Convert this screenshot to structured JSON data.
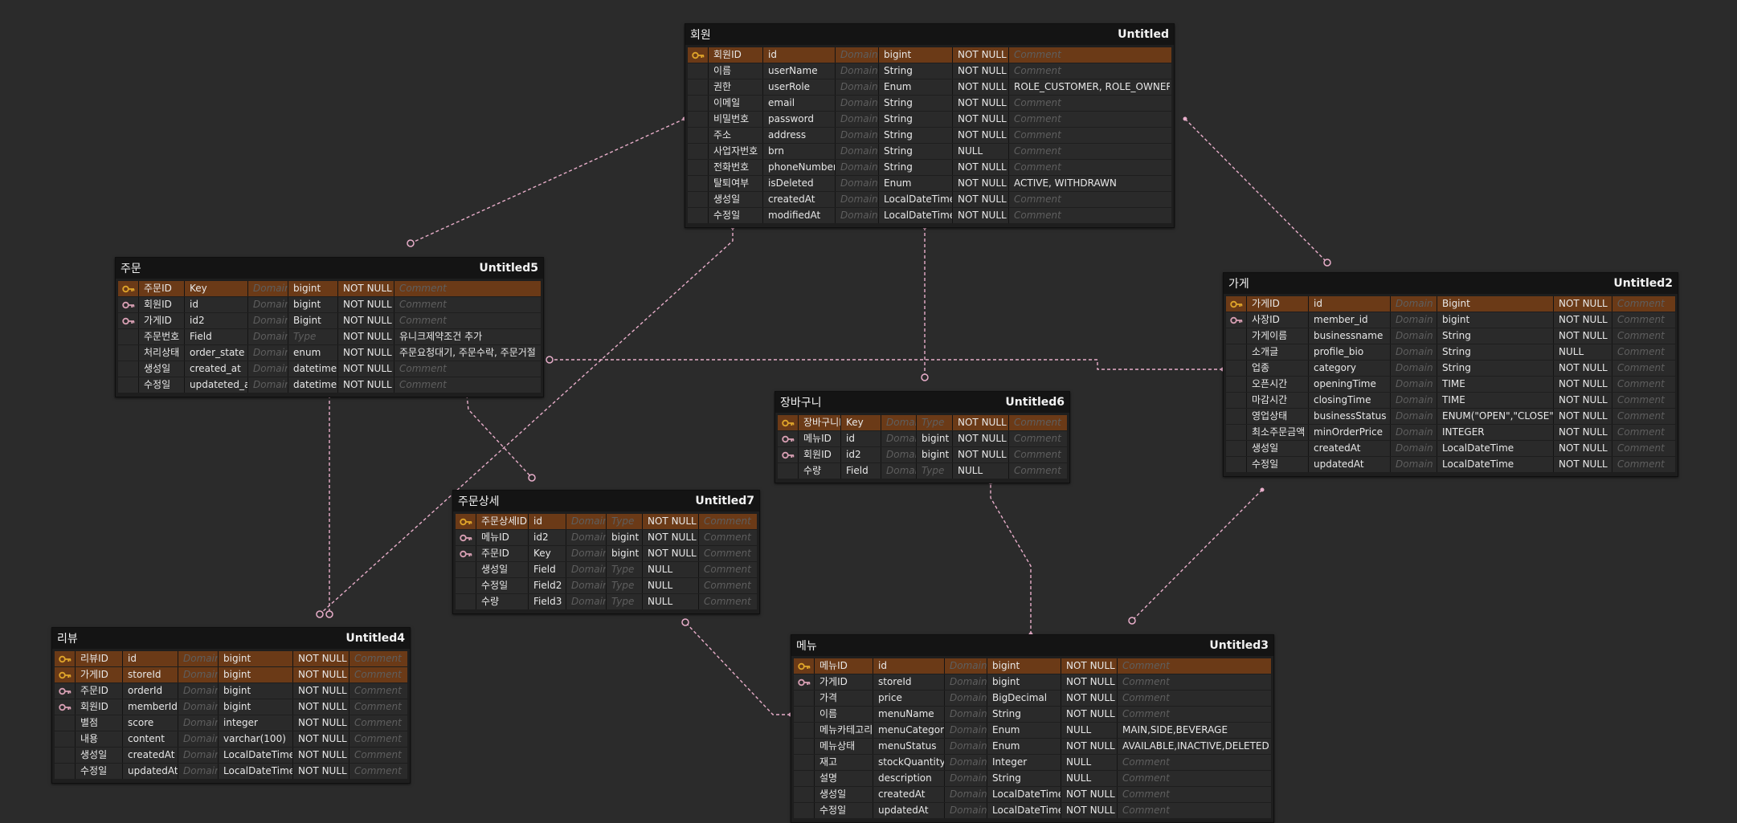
{
  "colors": {
    "background": "#2b2b2b",
    "pk_row": "#6b3a17",
    "pk_key": "#e0a52a",
    "fk_key": "#d9a0b4",
    "relation_line": "#e8aeca"
  },
  "tables": [
    {
      "id": "members",
      "title": "회원",
      "alias": "Untitled",
      "rows": [
        {
          "key": "pk",
          "logical": "회원ID",
          "physical": "id",
          "domain": "Domain",
          "type": "bigint",
          "nullable": "NOT NULL",
          "comment": "Comment"
        },
        {
          "key": "",
          "logical": "이름",
          "physical": "userName",
          "domain": "Domain",
          "type": "String",
          "nullable": "NOT NULL",
          "comment": "Comment"
        },
        {
          "key": "",
          "logical": "권한",
          "physical": "userRole",
          "domain": "Domain",
          "type": "Enum",
          "nullable": "NOT NULL",
          "comment": "ROLE_CUSTOMER, ROLE_OWNER"
        },
        {
          "key": "",
          "logical": "이메일",
          "physical": "email",
          "domain": "Domain",
          "type": "String",
          "nullable": "NOT NULL",
          "comment": "Comment"
        },
        {
          "key": "",
          "logical": "비밀번호",
          "physical": "password",
          "domain": "Domain",
          "type": "String",
          "nullable": "NOT NULL",
          "comment": "Comment"
        },
        {
          "key": "",
          "logical": "주소",
          "physical": "address",
          "domain": "Domain",
          "type": "String",
          "nullable": "NOT NULL",
          "comment": "Comment"
        },
        {
          "key": "",
          "logical": "사업자번호",
          "physical": "brn",
          "domain": "Domain",
          "type": "String",
          "nullable": "NULL",
          "comment": "Comment"
        },
        {
          "key": "",
          "logical": "전화번호",
          "physical": "phoneNumber",
          "domain": "Domain",
          "type": "String",
          "nullable": "NOT NULL",
          "comment": "Comment"
        },
        {
          "key": "",
          "logical": "탈퇴여부",
          "physical": "isDeleted",
          "domain": "Domain",
          "type": "Enum",
          "nullable": "NOT NULL",
          "comment": "ACTIVE, WITHDRAWN"
        },
        {
          "key": "",
          "logical": "생성일",
          "physical": "createdAt",
          "domain": "Domain",
          "type": "LocalDateTime",
          "nullable": "NOT NULL",
          "comment": "Comment"
        },
        {
          "key": "",
          "logical": "수정일",
          "physical": "modifiedAt",
          "domain": "Domain",
          "type": "LocalDateTime",
          "nullable": "NOT NULL",
          "comment": "Comment"
        }
      ]
    },
    {
      "id": "orders",
      "title": "주문",
      "alias": "Untitled5",
      "rows": [
        {
          "key": "pk",
          "logical": "주문ID",
          "physical": "Key",
          "domain": "Domain",
          "type": "bigint",
          "nullable": "NOT NULL",
          "comment": "Comment"
        },
        {
          "key": "fk",
          "logical": "회원ID",
          "physical": "id",
          "domain": "Domain",
          "type": "bigint",
          "nullable": "NOT NULL",
          "comment": "Comment"
        },
        {
          "key": "fk",
          "logical": "가게ID",
          "physical": "id2",
          "domain": "Domain",
          "type": "Bigint",
          "nullable": "NOT NULL",
          "comment": "Comment"
        },
        {
          "key": "",
          "logical": "주문번호",
          "physical": "Field",
          "domain": "Domain",
          "type": "Type",
          "nullable": "NOT NULL",
          "comment": "유니크제약조건 추가"
        },
        {
          "key": "",
          "logical": "처리상태",
          "physical": "order_state",
          "domain": "Domain",
          "type": "enum",
          "nullable": "NOT NULL",
          "comment": "주문요청대기, 주문수락, 주문거절 ..."
        },
        {
          "key": "",
          "logical": "생성일",
          "physical": "created_at",
          "domain": "Domain",
          "type": "datetime",
          "nullable": "NOT NULL",
          "comment": "Comment"
        },
        {
          "key": "",
          "logical": "수정일",
          "physical": "updateted_at",
          "domain": "Domain",
          "type": "datetime",
          "nullable": "NOT NULL",
          "comment": "Comment"
        }
      ]
    },
    {
      "id": "stores",
      "title": "가게",
      "alias": "Untitled2",
      "rows": [
        {
          "key": "pk",
          "logical": "가게ID",
          "physical": "id",
          "domain": "Domain",
          "type": "Bigint",
          "nullable": "NOT NULL",
          "comment": "Comment"
        },
        {
          "key": "fk",
          "logical": "사장ID",
          "physical": "member_id",
          "domain": "Domain",
          "type": "bigint",
          "nullable": "NOT NULL",
          "comment": "Comment"
        },
        {
          "key": "",
          "logical": "가게이름",
          "physical": "businessname",
          "domain": "Domain",
          "type": "String",
          "nullable": "NOT NULL",
          "comment": "Comment"
        },
        {
          "key": "",
          "logical": "소개글",
          "physical": "profile_bio",
          "domain": "Domain",
          "type": "String",
          "nullable": "NULL",
          "comment": "Comment"
        },
        {
          "key": "",
          "logical": "업종",
          "physical": "category",
          "domain": "Domain",
          "type": "String",
          "nullable": "NOT NULL",
          "comment": "Comment"
        },
        {
          "key": "",
          "logical": "오픈시간",
          "physical": "openingTime",
          "domain": "Domain",
          "type": "TIME",
          "nullable": "NOT NULL",
          "comment": "Comment"
        },
        {
          "key": "",
          "logical": "마감시간",
          "physical": "closingTime",
          "domain": "Domain",
          "type": "TIME",
          "nullable": "NOT NULL",
          "comment": "Comment"
        },
        {
          "key": "",
          "logical": "영업상태",
          "physical": "businessStatus",
          "domain": "Domain",
          "type": "ENUM(\"OPEN\",\"CLOSE\"",
          "nullable": "NOT NULL",
          "comment": "Comment"
        },
        {
          "key": "",
          "logical": "최소주문금액",
          "physical": "minOrderPrice",
          "domain": "Domain",
          "type": "INTEGER",
          "nullable": "NOT NULL",
          "comment": "Comment"
        },
        {
          "key": "",
          "logical": "생성일",
          "physical": "createdAt",
          "domain": "Domain",
          "type": "LocalDateTime",
          "nullable": "NOT NULL",
          "comment": "Comment"
        },
        {
          "key": "",
          "logical": "수정일",
          "physical": "updatedAt",
          "domain": "Domain",
          "type": "LocalDateTime",
          "nullable": "NOT NULL",
          "comment": "Comment"
        }
      ]
    },
    {
      "id": "carts",
      "title": "장바구니",
      "alias": "Untitled6",
      "rows": [
        {
          "key": "pk",
          "logical": "장바구니ID",
          "physical": "Key",
          "domain": "Domain",
          "type": "Type",
          "nullable": "NOT NULL",
          "comment": "Comment"
        },
        {
          "key": "fk",
          "logical": "메뉴ID",
          "physical": "id",
          "domain": "Domain",
          "type": "bigint",
          "nullable": "NOT NULL",
          "comment": "Comment"
        },
        {
          "key": "fk",
          "logical": "회원ID",
          "physical": "id2",
          "domain": "Domain",
          "type": "bigint",
          "nullable": "NOT NULL",
          "comment": "Comment"
        },
        {
          "key": "",
          "logical": "수량",
          "physical": "Field",
          "domain": "Domain",
          "type": "Type",
          "nullable": "NULL",
          "comment": "Comment"
        }
      ]
    },
    {
      "id": "order_details",
      "title": "주문상세",
      "alias": "Untitled7",
      "rows": [
        {
          "key": "pk",
          "logical": "주문상세ID",
          "physical": "id",
          "domain": "Domain",
          "type": "Type",
          "nullable": "NOT NULL",
          "comment": "Comment"
        },
        {
          "key": "fk",
          "logical": "메뉴ID",
          "physical": "id2",
          "domain": "Domain",
          "type": "bigint",
          "nullable": "NOT NULL",
          "comment": "Comment"
        },
        {
          "key": "fk",
          "logical": "주문ID",
          "physical": "Key",
          "domain": "Domain",
          "type": "bigint",
          "nullable": "NOT NULL",
          "comment": "Comment"
        },
        {
          "key": "",
          "logical": "생성일",
          "physical": "Field",
          "domain": "Domain",
          "type": "Type",
          "nullable": "NULL",
          "comment": "Comment"
        },
        {
          "key": "",
          "logical": "수정일",
          "physical": "Field2",
          "domain": "Domain",
          "type": "Type",
          "nullable": "NULL",
          "comment": "Comment"
        },
        {
          "key": "",
          "logical": "수량",
          "physical": "Field3",
          "domain": "Domain",
          "type": "Type",
          "nullable": "NULL",
          "comment": "Comment"
        }
      ]
    },
    {
      "id": "reviews",
      "title": "리뷰",
      "alias": "Untitled4",
      "rows": [
        {
          "key": "pk",
          "logical": "리뷰ID",
          "physical": "id",
          "domain": "Domain",
          "type": "bigint",
          "nullable": "NOT NULL",
          "comment": "Comment"
        },
        {
          "key": "pk",
          "logical": "가게ID",
          "physical": "storeId",
          "domain": "Domain",
          "type": "bigint",
          "nullable": "NOT NULL",
          "comment": "Comment"
        },
        {
          "key": "fk",
          "logical": "주문ID",
          "physical": "orderId",
          "domain": "Domain",
          "type": "bigint",
          "nullable": "NOT NULL",
          "comment": "Comment"
        },
        {
          "key": "fk",
          "logical": "회원ID",
          "physical": "memberId",
          "domain": "Domain",
          "type": "bigint",
          "nullable": "NOT NULL",
          "comment": "Comment"
        },
        {
          "key": "",
          "logical": "별점",
          "physical": "score",
          "domain": "Domain",
          "type": "integer",
          "nullable": "NOT NULL",
          "comment": "Comment"
        },
        {
          "key": "",
          "logical": "내용",
          "physical": "content",
          "domain": "Domain",
          "type": "varchar(100)",
          "nullable": "NOT NULL",
          "comment": "Comment"
        },
        {
          "key": "",
          "logical": "생성일",
          "physical": "createdAt",
          "domain": "Domain",
          "type": "LocalDateTime",
          "nullable": "NOT NULL",
          "comment": "Comment"
        },
        {
          "key": "",
          "logical": "수정일",
          "physical": "updatedAt",
          "domain": "Domain",
          "type": "LocalDateTime",
          "nullable": "NOT NULL",
          "comment": "Comment"
        }
      ]
    },
    {
      "id": "menus",
      "title": "메뉴",
      "alias": "Untitled3",
      "rows": [
        {
          "key": "pk",
          "logical": "메뉴ID",
          "physical": "id",
          "domain": "Domain",
          "type": "bigint",
          "nullable": "NOT NULL",
          "comment": "Comment"
        },
        {
          "key": "fk",
          "logical": "가게ID",
          "physical": "storeId",
          "domain": "Domain",
          "type": "bigint",
          "nullable": "NOT NULL",
          "comment": "Comment"
        },
        {
          "key": "",
          "logical": "가격",
          "physical": "price",
          "domain": "Domain",
          "type": "BigDecimal",
          "nullable": "NOT NULL",
          "comment": "Comment"
        },
        {
          "key": "",
          "logical": "이름",
          "physical": "menuName",
          "domain": "Domain",
          "type": "String",
          "nullable": "NOT NULL",
          "comment": "Comment"
        },
        {
          "key": "",
          "logical": "메뉴카테고리",
          "physical": "menuCategory",
          "domain": "Domain",
          "type": "Enum",
          "nullable": "NULL",
          "comment": "MAIN,SIDE,BEVERAGE"
        },
        {
          "key": "",
          "logical": "메뉴상태",
          "physical": "menuStatus",
          "domain": "Domain",
          "type": "Enum",
          "nullable": "NOT NULL",
          "comment": "AVAILABLE,INACTIVE,DELETED"
        },
        {
          "key": "",
          "logical": "재고",
          "physical": "stockQuantity",
          "domain": "Domain",
          "type": "Integer",
          "nullable": "NULL",
          "comment": "Comment"
        },
        {
          "key": "",
          "logical": "설명",
          "physical": "description",
          "domain": "Domain",
          "type": "String",
          "nullable": "NULL",
          "comment": "Comment"
        },
        {
          "key": "",
          "logical": "생성일",
          "physical": "createdAt",
          "domain": "Domain",
          "type": "LocalDateTime",
          "nullable": "NOT NULL",
          "comment": "Comment"
        },
        {
          "key": "",
          "logical": "수정일",
          "physical": "updatedAt",
          "domain": "Domain",
          "type": "LocalDateTime",
          "nullable": "NOT NULL",
          "comment": "Comment"
        }
      ]
    }
  ],
  "relations": [
    {
      "from": "members",
      "to": "orders",
      "cardinality": "one-to-many"
    },
    {
      "from": "members",
      "to": "stores",
      "cardinality": "one-to-many"
    },
    {
      "from": "members",
      "to": "carts",
      "cardinality": "one-to-many"
    },
    {
      "from": "members",
      "to": "reviews",
      "cardinality": "one-to-many"
    },
    {
      "from": "stores",
      "to": "orders",
      "cardinality": "one-to-many"
    },
    {
      "from": "stores",
      "to": "menus",
      "cardinality": "one-to-many"
    },
    {
      "from": "orders",
      "to": "reviews",
      "cardinality": "one-to-many"
    },
    {
      "from": "orders",
      "to": "order_details",
      "cardinality": "one-to-many"
    },
    {
      "from": "menus",
      "to": "carts",
      "cardinality": "one-to-many"
    },
    {
      "from": "menus",
      "to": "order_details",
      "cardinality": "one-to-many"
    }
  ]
}
